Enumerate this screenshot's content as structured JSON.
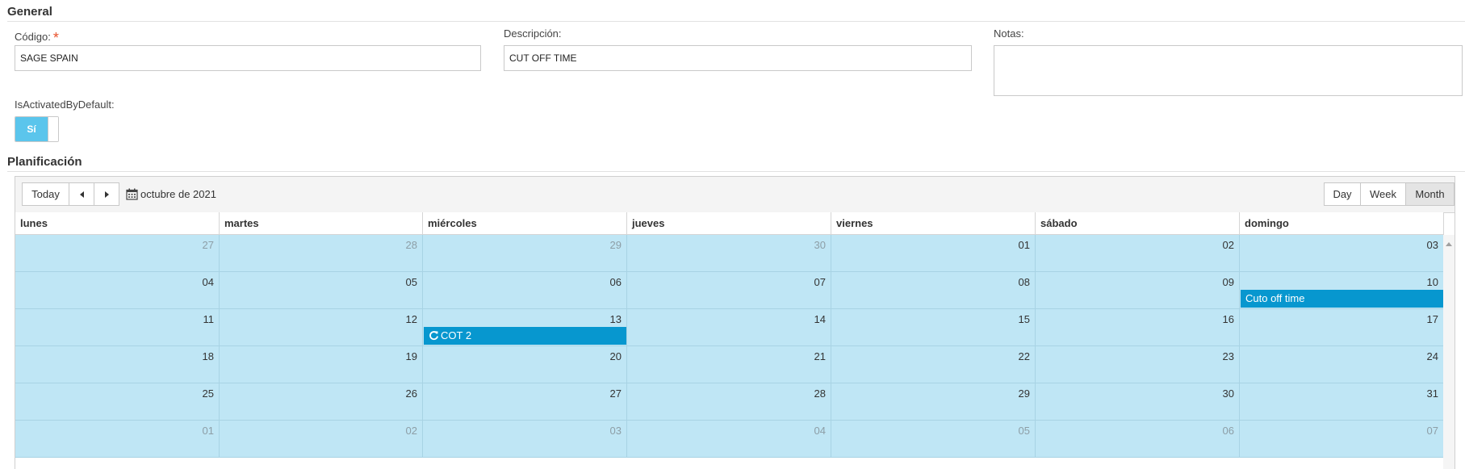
{
  "general": {
    "title": "General",
    "codigo": {
      "label": "Código:",
      "required_mark": "*",
      "value": "SAGE SPAIN"
    },
    "descripcion": {
      "label": "Descripción:",
      "value": "CUT OFF TIME"
    },
    "notas": {
      "label": "Notas:",
      "value": ""
    },
    "is_activated": {
      "label": "IsActivatedByDefault:",
      "on_label": "Sí",
      "state": true
    }
  },
  "planificacion": {
    "title": "Planificación",
    "toolbar": {
      "today_label": "Today",
      "current_period": "octubre de 2021",
      "views": [
        {
          "label": "Day",
          "active": false
        },
        {
          "label": "Week",
          "active": false
        },
        {
          "label": "Month",
          "active": true
        }
      ]
    },
    "weekdays": [
      "lunes",
      "martes",
      "miércoles",
      "jueves",
      "viernes",
      "sábado",
      "domingo"
    ],
    "weeks": [
      [
        {
          "n": "27",
          "other": true
        },
        {
          "n": "28",
          "other": true
        },
        {
          "n": "29",
          "other": true
        },
        {
          "n": "30",
          "other": true
        },
        {
          "n": "01",
          "other": false
        },
        {
          "n": "02",
          "other": false
        },
        {
          "n": "03",
          "other": false
        }
      ],
      [
        {
          "n": "04",
          "other": false
        },
        {
          "n": "05",
          "other": false
        },
        {
          "n": "06",
          "other": false
        },
        {
          "n": "07",
          "other": false
        },
        {
          "n": "08",
          "other": false
        },
        {
          "n": "09",
          "other": false
        },
        {
          "n": "10",
          "other": false
        }
      ],
      [
        {
          "n": "11",
          "other": false
        },
        {
          "n": "12",
          "other": false
        },
        {
          "n": "13",
          "other": false
        },
        {
          "n": "14",
          "other": false
        },
        {
          "n": "15",
          "other": false
        },
        {
          "n": "16",
          "other": false
        },
        {
          "n": "17",
          "other": false
        }
      ],
      [
        {
          "n": "18",
          "other": false
        },
        {
          "n": "19",
          "other": false
        },
        {
          "n": "20",
          "other": false
        },
        {
          "n": "21",
          "other": false
        },
        {
          "n": "22",
          "other": false
        },
        {
          "n": "23",
          "other": false
        },
        {
          "n": "24",
          "other": false
        }
      ],
      [
        {
          "n": "25",
          "other": false
        },
        {
          "n": "26",
          "other": false
        },
        {
          "n": "27",
          "other": false
        },
        {
          "n": "28",
          "other": false
        },
        {
          "n": "29",
          "other": false
        },
        {
          "n": "30",
          "other": false
        },
        {
          "n": "31",
          "other": false
        }
      ],
      [
        {
          "n": "01",
          "other": true
        },
        {
          "n": "02",
          "other": true
        },
        {
          "n": "03",
          "other": true
        },
        {
          "n": "04",
          "other": true
        },
        {
          "n": "05",
          "other": true
        },
        {
          "n": "06",
          "other": true
        },
        {
          "n": "07",
          "other": true
        }
      ]
    ],
    "events": [
      {
        "title": "Cuto off time",
        "week": 1,
        "day": 6,
        "recurring": false
      },
      {
        "title": "COT 2",
        "week": 2,
        "day": 2,
        "recurring": true
      }
    ],
    "colors": {
      "cell_bg": "#bfe6f5",
      "event_bg": "#0797cf",
      "switch_on": "#5bc5ec"
    }
  }
}
